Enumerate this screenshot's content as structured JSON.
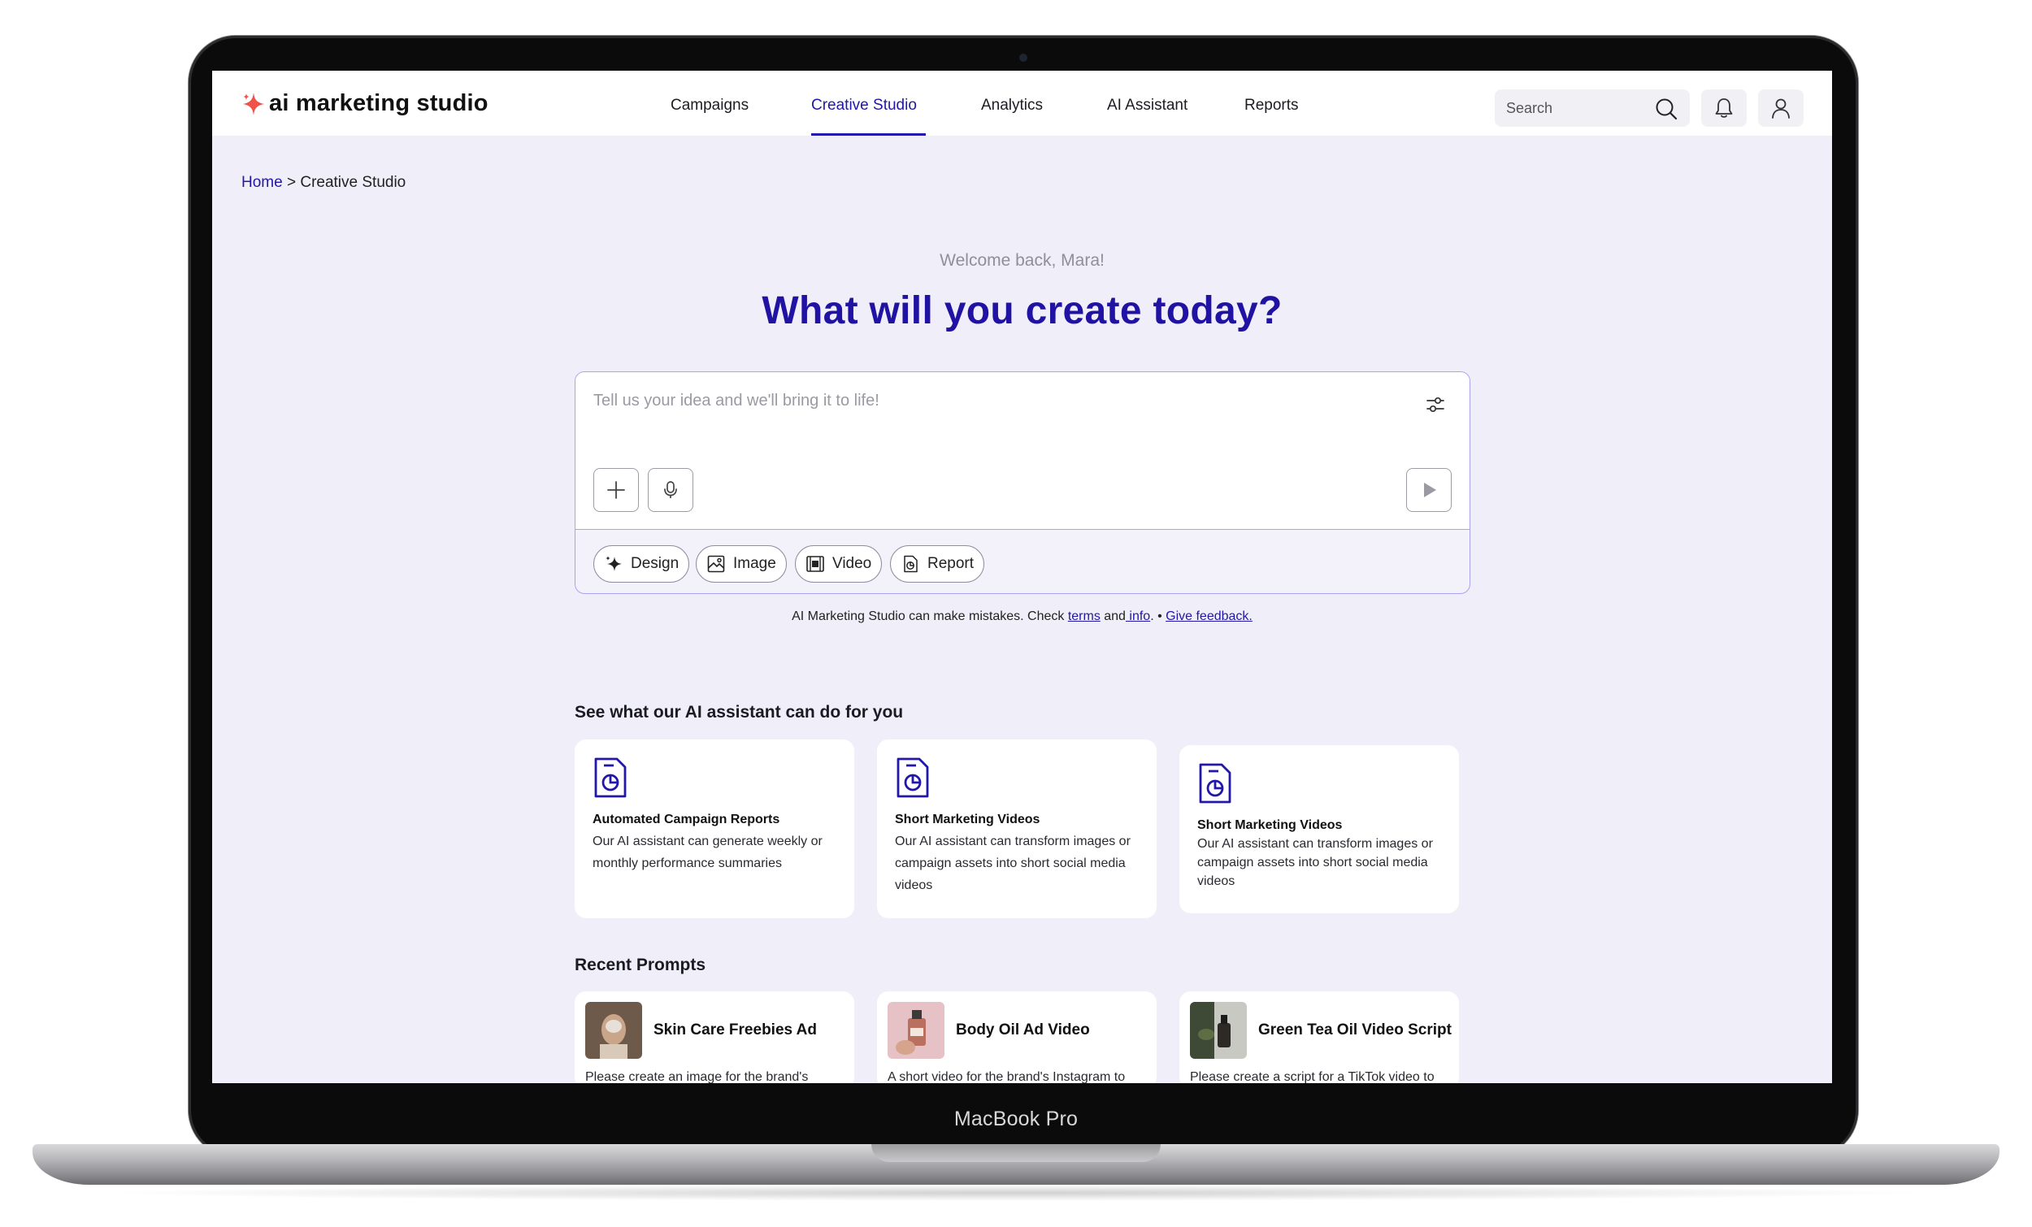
{
  "device": {
    "label": "MacBook Pro"
  },
  "app": {
    "logo_text": "ai marketing studio",
    "accent_color": "#2217a8",
    "logo_color": "#f0524a"
  },
  "nav": {
    "items": [
      "Campaigns",
      "Creative Studio",
      "Analytics",
      "AI Assistant",
      "Reports"
    ],
    "active": "Creative Studio"
  },
  "search": {
    "placeholder": "Search"
  },
  "header_icons": [
    "search-icon",
    "bell-icon",
    "user-icon"
  ],
  "breadcrumb": {
    "home": "Home",
    "separator": " > ",
    "current": "Creative Studio"
  },
  "hero": {
    "welcome": "Welcome back, Mara!",
    "headline": "What will you create today?"
  },
  "prompt": {
    "placeholder": "Tell us your idea and we'll bring it to life!",
    "chips": [
      "Design",
      "Image",
      "Video",
      "Report"
    ]
  },
  "disclaimer": {
    "text": "AI Marketing Studio can make mistakes. Check ",
    "terms": "terms",
    "and": " and",
    "info": " info",
    "sep": ". • ",
    "feedback": "Give feedback."
  },
  "capabilities": {
    "title": "See what our AI assistant can do for you",
    "cards": [
      {
        "title": "Automated Campaign Reports",
        "body": "Our AI assistant can generate weekly or monthly performance summaries"
      },
      {
        "title": "Short Marketing Videos",
        "body": "Our AI assistant can transform images or campaign assets into short social media videos"
      },
      {
        "title": "Short Marketing Videos",
        "body": "Our AI assistant can transform images or campaign assets into short social media videos"
      }
    ]
  },
  "recent": {
    "title": "Recent Prompts",
    "items": [
      {
        "title": "Skin Care Freebies Ad",
        "body": "Please create an image for the brand's"
      },
      {
        "title": "Body Oil Ad Video",
        "body": "A short video for the brand's Instagram to"
      },
      {
        "title": "Green Tea Oil Video Script",
        "body": "Please create a script for a TikTok video to"
      }
    ]
  }
}
